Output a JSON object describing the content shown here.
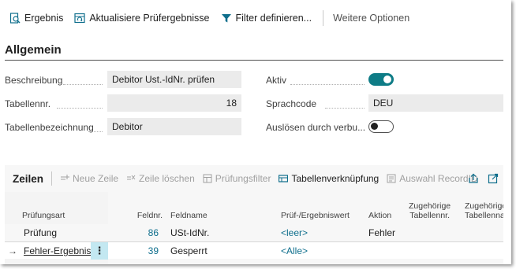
{
  "actionbar": {
    "items": [
      {
        "label": "Ergebnis",
        "icon": "search-doc-icon"
      },
      {
        "label": "Aktualisiere Prüfergebnisse",
        "icon": "refresh-table-icon"
      },
      {
        "label": "Filter definieren...",
        "icon": "filter-icon"
      }
    ],
    "more": "Weitere Optionen"
  },
  "general": {
    "title": "Allgemein",
    "beschreibung_label": "Beschreibung",
    "beschreibung_value": "Debitor Ust.-IdNr. prüfen",
    "tabellennr_label": "Tabellennr.",
    "tabellennr_value": "18",
    "tabellenbez_label": "Tabellenbezeichnung",
    "tabellenbez_value": "Debitor",
    "aktiv_label": "Aktiv",
    "aktiv_on": true,
    "sprachcode_label": "Sprachcode",
    "sprachcode_value": "DEU",
    "ausloesen_label": "Auslösen durch verbu...",
    "ausloesen_on": false
  },
  "lines": {
    "title": "Zeilen",
    "actions": [
      {
        "label": "Neue Zeile",
        "enabled": false,
        "icon": "new-line-icon"
      },
      {
        "label": "Zeile löschen",
        "enabled": false,
        "icon": "delete-line-icon"
      },
      {
        "label": "Prüfungsfilter",
        "enabled": false,
        "icon": "check-filter-icon"
      },
      {
        "label": "Tabellenverknüpfung",
        "enabled": true,
        "icon": "table-link-icon"
      },
      {
        "label": "Auswahl RecordID",
        "enabled": false,
        "icon": "record-select-icon"
      }
    ],
    "columns": {
      "pruefungsart": "Prüfungsart",
      "feldnr": "Feldnr.",
      "feldname": "Feldname",
      "pruefwert": "Prüf-/Ergebniswert",
      "aktion": "Aktion",
      "zug_tabellennr_1": "Zugehörige",
      "zug_tabellennr_2": "Tabellennr.",
      "zug_tabellenname_1": "Zugehöriger",
      "zug_tabellenname_2": "Tabellenname"
    },
    "rows": [
      {
        "pruefungsart": "Prüfung",
        "feldnr": "86",
        "feldname": "USt-IdNr.",
        "pruefwert": "<leer>",
        "aktion": "Fehler"
      },
      {
        "marker": "→",
        "pruefungsart": "Fehler-Ergebnis",
        "feldnr": "39",
        "feldname": "Gesperrt",
        "pruefwert": "<Alle>",
        "aktion": ""
      }
    ]
  },
  "colors": {
    "accent": "#0e7c86",
    "link": "#0e6e8c",
    "selected_cell": "#c3e8f1"
  }
}
